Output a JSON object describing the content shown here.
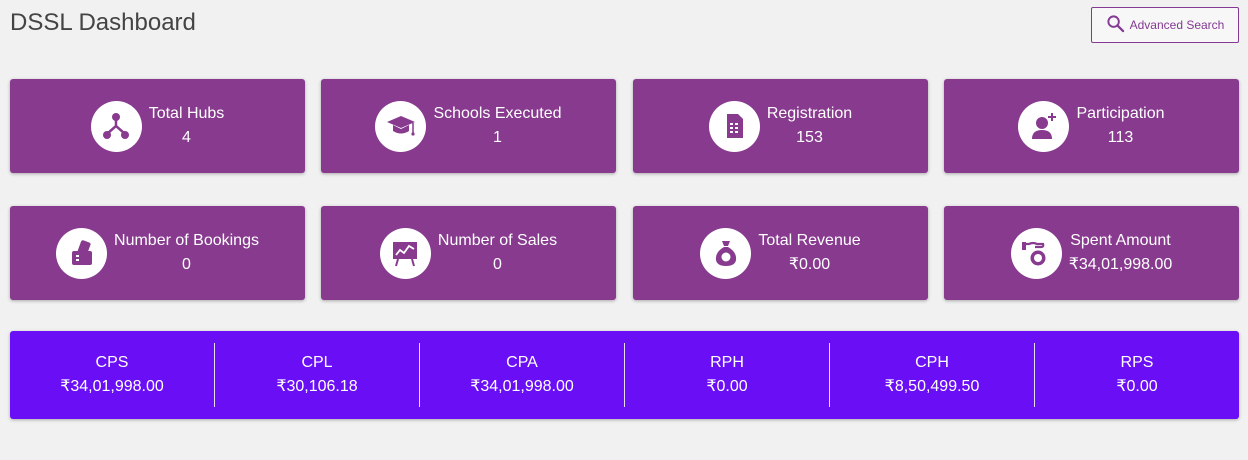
{
  "header": {
    "title": "DSSL Dashboard",
    "advanced_search_label": "Advanced Search"
  },
  "cards": [
    {
      "label": "Total Hubs",
      "value": "4",
      "icon": "hub-network-icon"
    },
    {
      "label": "Schools Executed",
      "value": "1",
      "icon": "graduation-cap-icon"
    },
    {
      "label": "Registration",
      "value": "153",
      "icon": "document-icon"
    },
    {
      "label": "Participation",
      "value": "113",
      "icon": "user-add-icon"
    },
    {
      "label": "Number of Bookings",
      "value": "0",
      "icon": "tickets-icon"
    },
    {
      "label": "Number of Sales",
      "value": "0",
      "icon": "sales-board-icon"
    },
    {
      "label": "Total Revenue",
      "value": "₹0.00",
      "icon": "money-bag-icon"
    },
    {
      "label": "Spent Amount",
      "value": "₹34,01,998.00",
      "icon": "hand-coin-icon"
    }
  ],
  "metrics": [
    {
      "label": "CPS",
      "value": "₹34,01,998.00"
    },
    {
      "label": "CPL",
      "value": "₹30,106.18"
    },
    {
      "label": "CPA",
      "value": "₹34,01,998.00"
    },
    {
      "label": "RPH",
      "value": "₹0.00"
    },
    {
      "label": "CPH",
      "value": "₹8,50,499.50"
    },
    {
      "label": "RPS",
      "value": "₹0.00"
    }
  ],
  "colors": {
    "card": "#873a8e",
    "metrics_bar": "#6a0ef5",
    "background": "#f1f1f1",
    "accent": "#843a94"
  }
}
